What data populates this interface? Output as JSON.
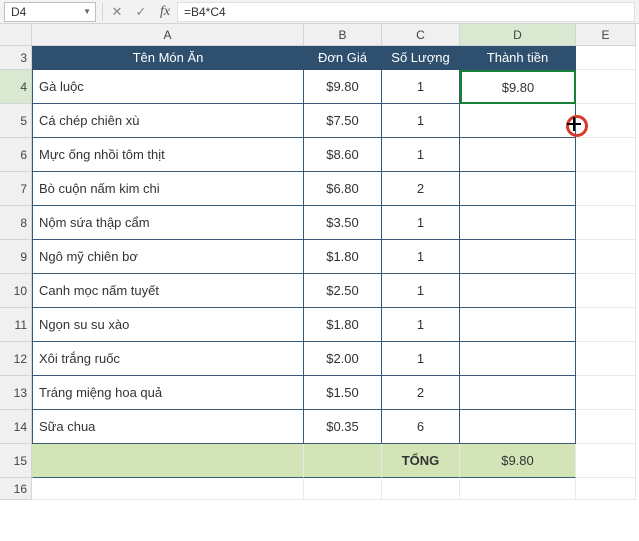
{
  "formula_bar": {
    "name_box": "D4",
    "cancel_glyph": "✕",
    "accept_glyph": "✓",
    "fx_glyph": "fx",
    "formula": "=B4*C4"
  },
  "columns": [
    "A",
    "B",
    "C",
    "D",
    "E"
  ],
  "row_numbers": [
    "3",
    "4",
    "5",
    "6",
    "7",
    "8",
    "9",
    "10",
    "11",
    "12",
    "13",
    "14",
    "15",
    "16"
  ],
  "headers": {
    "a": "Tên Món Ăn",
    "b": "Đơn Giá",
    "c": "Số Lượng",
    "d": "Thành tiền"
  },
  "rows": [
    {
      "a": "Gà luộc",
      "b": "$9.80",
      "c": "1",
      "d": "$9.80"
    },
    {
      "a": "Cá chép chiên xù",
      "b": "$7.50",
      "c": "1",
      "d": ""
    },
    {
      "a": "Mực ống nhồi tôm thịt",
      "b": "$8.60",
      "c": "1",
      "d": ""
    },
    {
      "a": "Bò cuộn nấm kim chi",
      "b": "$6.80",
      "c": "2",
      "d": ""
    },
    {
      "a": "Nộm sứa thập cẩm",
      "b": "$3.50",
      "c": "1",
      "d": ""
    },
    {
      "a": "Ngô mỹ chiên bơ",
      "b": "$1.80",
      "c": "1",
      "d": ""
    },
    {
      "a": "Canh mọc nấm tuyết",
      "b": "$2.50",
      "c": "1",
      "d": ""
    },
    {
      "a": "Ngọn su su xào",
      "b": "$1.80",
      "c": "1",
      "d": ""
    },
    {
      "a": "Xôi trắng ruốc",
      "b": "$2.00",
      "c": "1",
      "d": ""
    },
    {
      "a": "Tráng miệng hoa quả",
      "b": "$1.50",
      "c": "2",
      "d": ""
    },
    {
      "a": "Sữa chua",
      "b": "$0.35",
      "c": "6",
      "d": ""
    }
  ],
  "total": {
    "label": "TỔNG",
    "value": "$9.80"
  },
  "selected_cell": "D4",
  "selected_column": "D",
  "selected_row": "4"
}
